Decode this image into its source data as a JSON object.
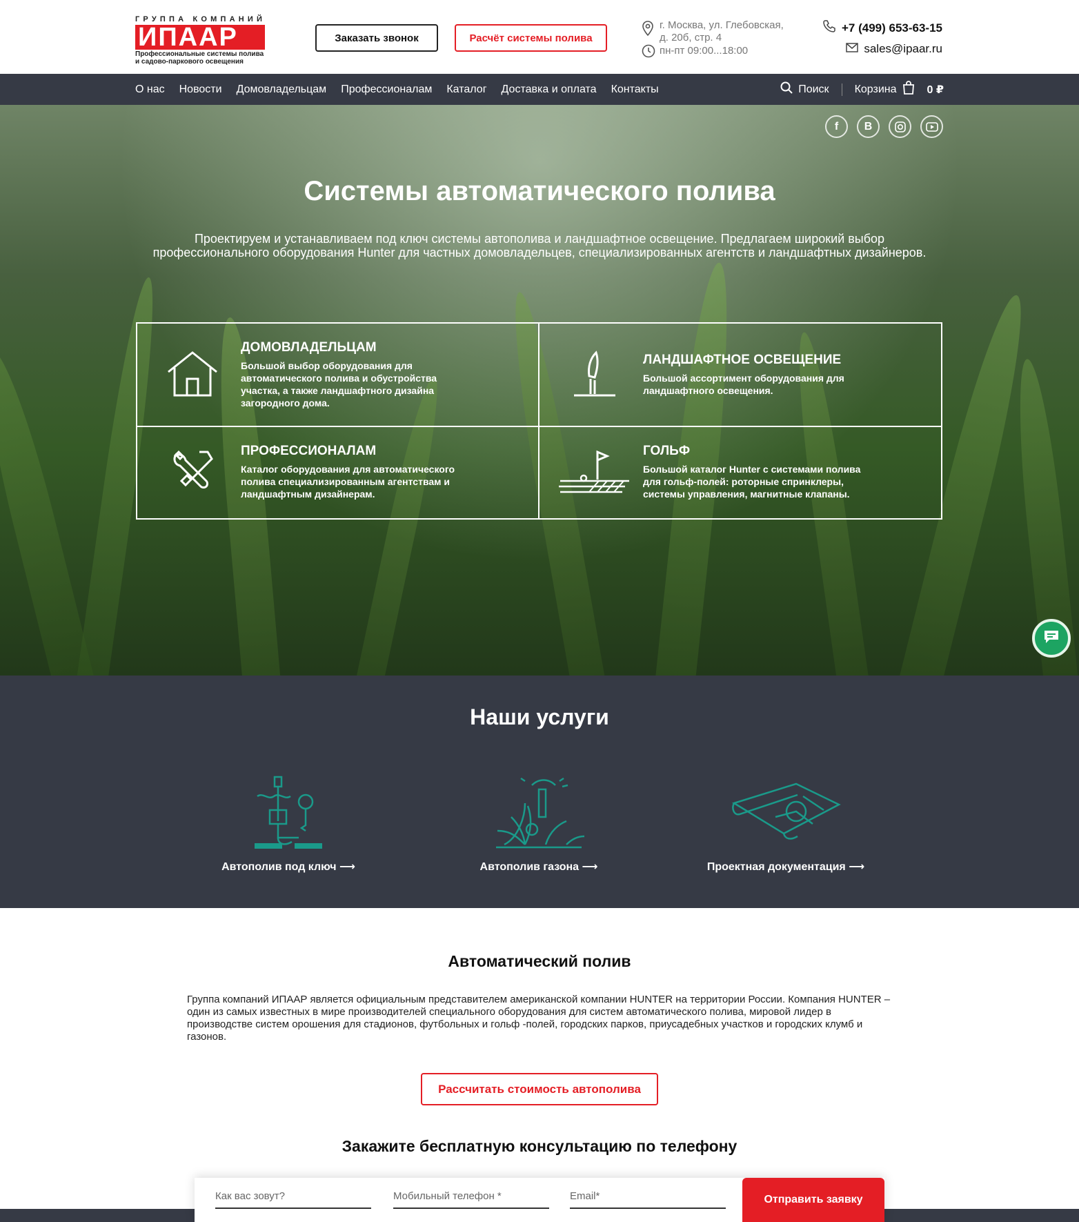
{
  "logo": {
    "top": "ГРУППА КОМПАНИЙ",
    "main": "ИПААР",
    "sub1": "Профессиональные системы полива",
    "sub2": "и садово-паркового освещения"
  },
  "header": {
    "call_button": "Заказать звонок",
    "calc_button": "Расчёт системы полива",
    "address_line1": "г. Москва, ул. Глебовская,",
    "address_line2": "д. 20б, стр. 4",
    "hours": "пн-пт 09:00...18:00",
    "phone": "+7 (499) 653-63-15",
    "email": "sales@ipaar.ru"
  },
  "nav": {
    "items": [
      "О нас",
      "Новости",
      "Домовладельцам",
      "Профессионалам",
      "Каталог",
      "Доставка и оплата",
      "Контакты"
    ],
    "search": "Поиск",
    "cart": "Корзина",
    "cart_total": "0 ₽"
  },
  "hero": {
    "title": "Системы автоматического полива",
    "text": "Проектируем и устанавливаем под ключ системы автополива и ландшафтное освещение. Предлагаем широкий выбор профессионального оборудования Hunter для частных домовладельцев, специализированных агентств и ландшафтных дизайнеров.",
    "socials": [
      "facebook-icon",
      "vk-icon",
      "instagram-icon",
      "youtube-icon"
    ],
    "cards": [
      {
        "title": "ДОМОВЛАДЕЛЬЦАМ",
        "text": "Большой выбор оборудования для автоматического полива и обустройства участка, а также ландшафтного дизайна загородного дома.",
        "icon": "house-icon"
      },
      {
        "title": "ЛАНДШАФТНОЕ ОСВЕЩЕНИЕ",
        "text": "Большой ассортимент оборудования для ландшафтного освещения.",
        "icon": "garden-lamp-icon"
      },
      {
        "title": "ПРОФЕССИОНАЛАМ",
        "text": "Каталог оборудования для автоматического полива специализированным агентствам и ландшафтным дизайнерам.",
        "icon": "tools-icon"
      },
      {
        "title": "ГОЛЬФ",
        "text": "Большой каталог Hunter с системами полива для гольф-полей: роторные спринклеры, системы управления, магнитные клапаны.",
        "icon": "golf-flag-icon"
      }
    ]
  },
  "services": {
    "title": "Наши услуги",
    "items": [
      {
        "label": "Автополив под ключ",
        "icon": "irrigation-key-icon"
      },
      {
        "label": "Автополив газона",
        "icon": "lawn-sprinkler-icon"
      },
      {
        "label": "Проектная документация",
        "icon": "blueprint-icon"
      }
    ]
  },
  "about": {
    "title": "Автоматический полив",
    "text": "Группа компаний ИПААР является официальным представителем американской компании HUNTER на территории России. Компания HUNTER – один из самых известных в мире производителей специального оборудования для систем автоматического полива, мировой лидер в производстве систем орошения для стадионов, футбольных и гольф -полей, городских парков, приусадебных участков и городских клумб и газонов.",
    "button": "Рассчитать стоимость автополива"
  },
  "consult": {
    "title": "Закажите бесплатную консультацию по телефону",
    "name_placeholder": "Как вас зовут?",
    "phone_placeholder": "Мобильный телефон *",
    "email_placeholder": "Email*",
    "submit": "Отправить заявку"
  },
  "colors": {
    "accent": "#e41e25",
    "dark": "#363a45",
    "teal": "#1a9a8a",
    "chat": "#1da462"
  }
}
